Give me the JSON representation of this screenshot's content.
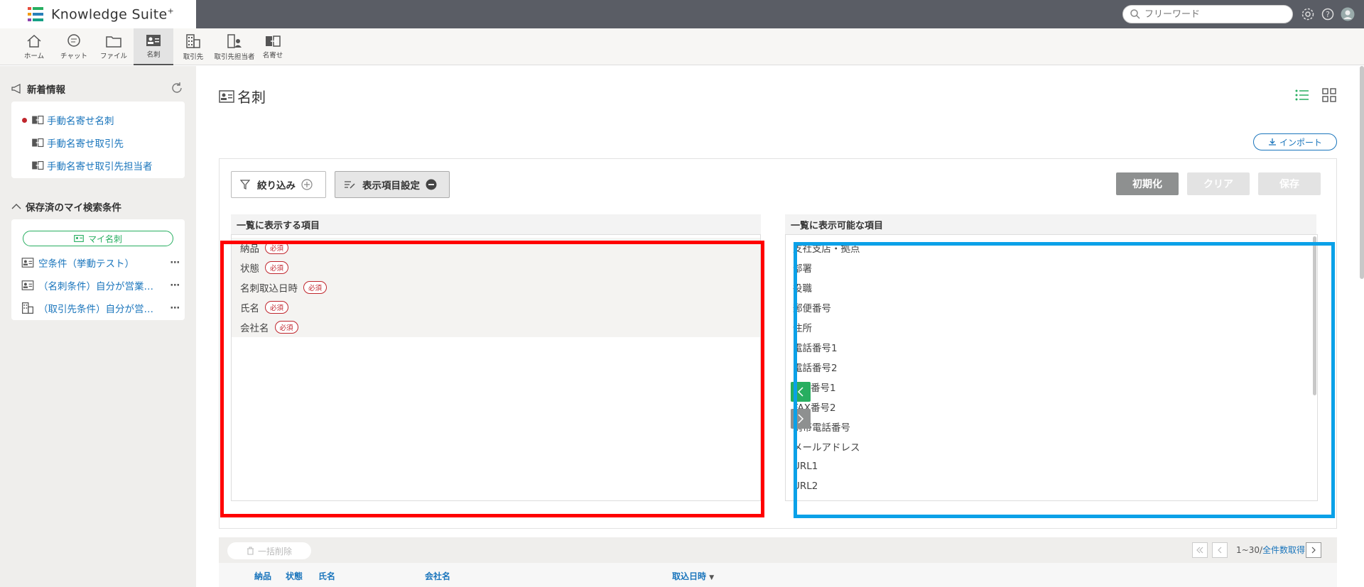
{
  "app": {
    "logo_text": "Knowledge Suite",
    "logo_mark": "+"
  },
  "search": {
    "placeholder": "フリーワード"
  },
  "nav": [
    {
      "label": "ホーム",
      "icon": "home-icon"
    },
    {
      "label": "チャット",
      "icon": "chat-icon"
    },
    {
      "label": "ファイル",
      "icon": "folder-icon"
    },
    {
      "label": "名刺",
      "icon": "business-card-icon",
      "active": true
    },
    {
      "label": "取引先",
      "icon": "building-icon"
    },
    {
      "label": "取引先担当者",
      "icon": "contact-person-icon"
    },
    {
      "label": "名寄せ",
      "icon": "merge-icon"
    }
  ],
  "sidebar": {
    "news_title": "新着情報",
    "news_items": [
      {
        "label": "手動名寄せ名刺",
        "unread": true
      },
      {
        "label": "手動名寄せ取引先",
        "unread": false
      },
      {
        "label": "手動名寄せ取引先担当者",
        "unread": false
      }
    ],
    "saved_title": "保存済のマイ検索条件",
    "my_card_button": "マイ名刺",
    "conditions": [
      {
        "label": "空条件（挙動テスト）",
        "icon": "business-card-icon"
      },
      {
        "label": "（名刺条件）自分が営業担当",
        "icon": "business-card-icon"
      },
      {
        "label": "（取引先条件）自分が営業担当",
        "icon": "building-icon"
      }
    ],
    "more_label": "⋯"
  },
  "main": {
    "title": "名刺",
    "import_label": "インポート",
    "filter_label": "絞り込み",
    "display_settings_label": "表示項目設定",
    "reset_label": "初期化",
    "clear_label": "クリア",
    "save_label": "保存",
    "left_header": "一覧に表示する項目",
    "right_header": "一覧に表示可能な項目",
    "required_badge": "必須",
    "displayed_fields": [
      "納品",
      "状態",
      "名刺取込日時",
      "氏名",
      "会社名"
    ],
    "available_fields": [
      "支社支店・拠点",
      "部署",
      "役職",
      "郵便番号",
      "住所",
      "電話番号1",
      "電話番号2",
      "FAX番号1",
      "FAX番号2",
      "携帯電話番号",
      "メールアドレス",
      "URL1",
      "URL2"
    ],
    "bulk_delete_label": "一括削除",
    "page_range": "1~30/",
    "page_all_link": "全件数取得",
    "table_columns": [
      "納品",
      "状態",
      "氏名",
      "会社名",
      "取込日時"
    ],
    "sort_indicator": "▼"
  },
  "colors": {
    "accent_green": "#27ae60",
    "link_blue": "#1a75bc",
    "required_red": "#c0262d",
    "highlight_red": "#ff0000",
    "highlight_blue": "#0aa1e8"
  }
}
